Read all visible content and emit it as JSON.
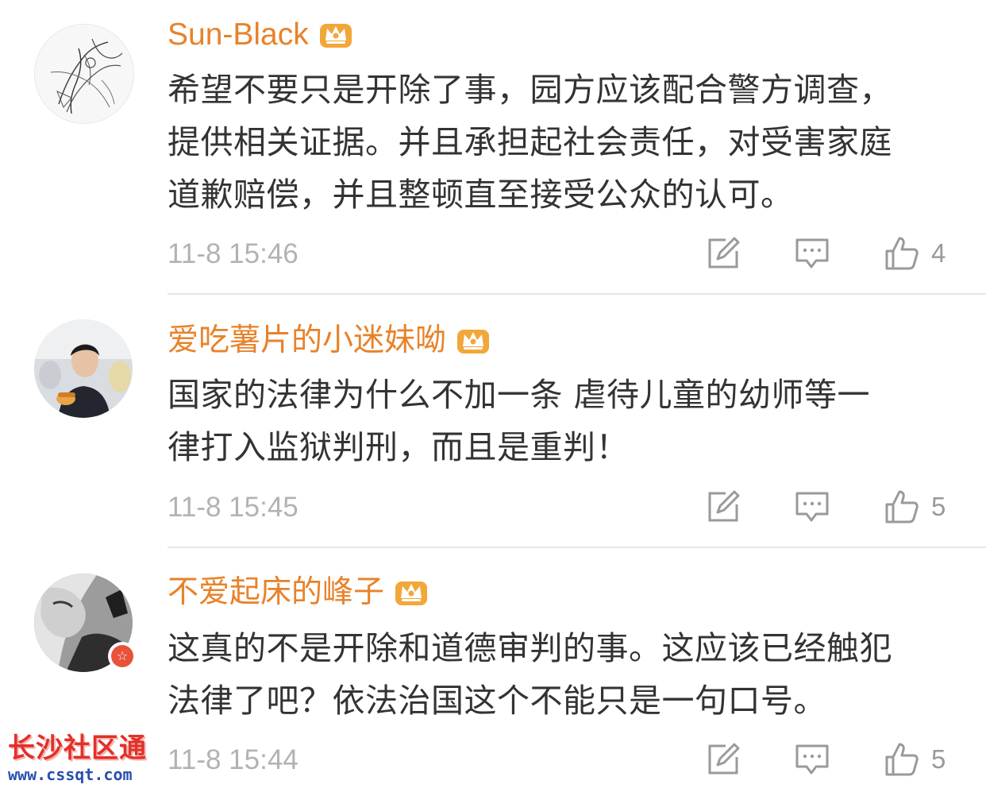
{
  "colors": {
    "username": "#e8822a",
    "body_text": "#333333",
    "timestamp": "#b2b2b2",
    "icon": "#9a9a9a",
    "crown": "#f2a73a",
    "divider": "#e6e6e6",
    "badge": "#e8513a",
    "watermark_title": "#e2302a",
    "watermark_url": "#2a4fae"
  },
  "comments": [
    {
      "username": "Sun-Black",
      "text": "希望不要只是开除了事，园方应该配合警方调查，\n提供相关证据。并且承担起社会责任，对受害家庭\n道歉赔偿，并且整顿直至接受公众的认可。",
      "timestamp": "11-8 15:46",
      "likes": "4",
      "crown_icon": "vip-crown-icon",
      "repost_icon": "repost-icon",
      "reply_icon": "comment-icon",
      "like_icon": "thumbs-up-icon"
    },
    {
      "username": "爱吃薯片的小迷妹呦",
      "text": "国家的法律为什么不加一条  虐待儿童的幼师等一\n律打入监狱判刑，而且是重判！",
      "timestamp": "11-8 15:45",
      "likes": "5",
      "crown_icon": "vip-crown-icon",
      "repost_icon": "repost-icon",
      "reply_icon": "comment-icon",
      "like_icon": "thumbs-up-icon"
    },
    {
      "username": "不爱起床的峰子",
      "text": "这真的不是开除和道德审判的事。这应该已经触犯\n法律了吧？依法治国这个不能只是一句口号。",
      "timestamp": "11-8 15:44",
      "likes": "5",
      "crown_icon": "vip-crown-icon",
      "badge_icon": "verified-star-badge-icon",
      "badge_text": "☆",
      "repost_icon": "repost-icon",
      "reply_icon": "comment-icon",
      "like_icon": "thumbs-up-icon"
    }
  ],
  "watermark": {
    "title": "长沙社区通",
    "url": "www.cssqt.com"
  }
}
